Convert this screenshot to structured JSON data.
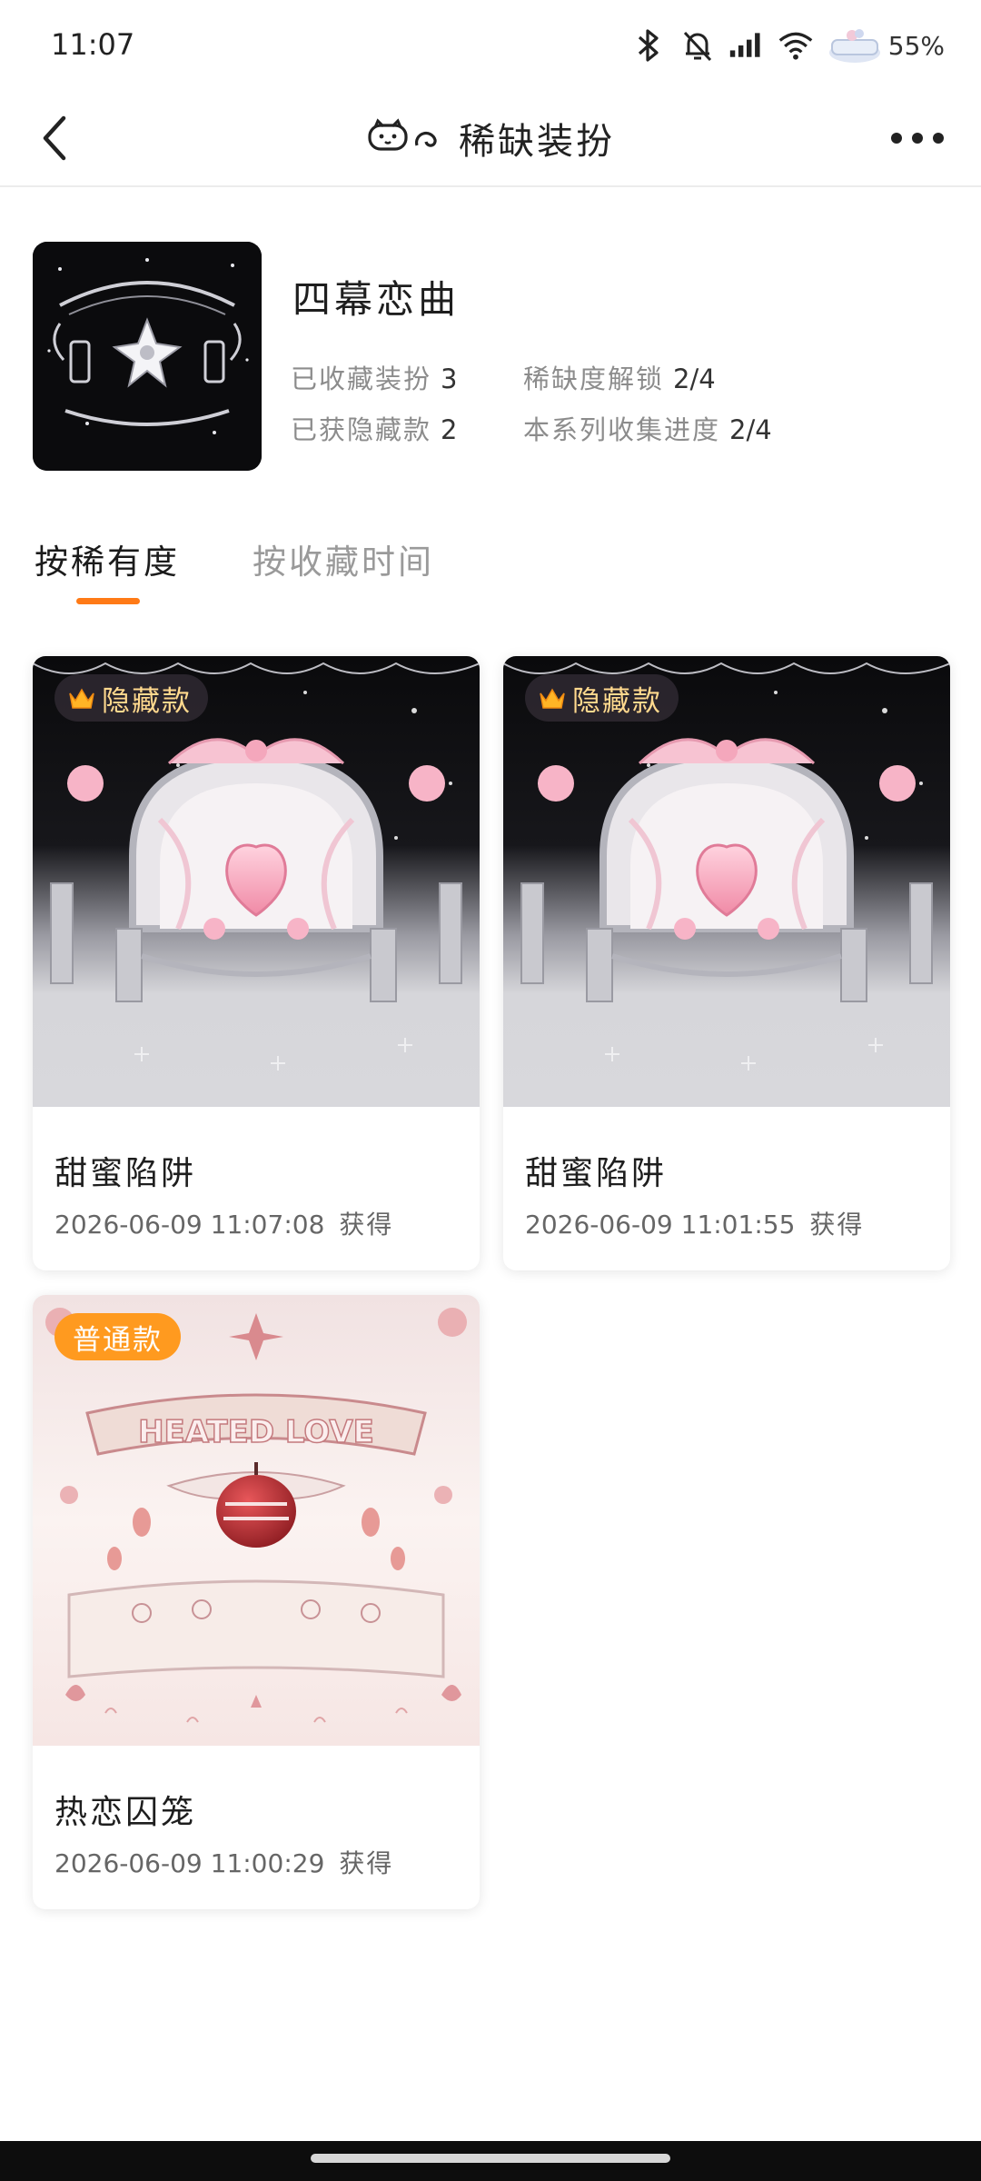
{
  "status_bar": {
    "time": "11:07",
    "battery": "55%",
    "icons": [
      "bluetooth-icon",
      "mute-bell-icon",
      "signal-icon",
      "wifi-icon",
      "battery-icon"
    ]
  },
  "nav": {
    "title": "稀缺装扮",
    "back_icon": "chevron-left-icon",
    "more_icon": "more-dots-icon"
  },
  "series": {
    "name": "四幕恋曲",
    "stats": [
      {
        "label": "已收藏装扮",
        "value": "3"
      },
      {
        "label": "稀缺度解锁",
        "value": "2/4"
      },
      {
        "label": "已获隐藏款",
        "value": "2"
      },
      {
        "label": "本系列收集进度",
        "value": "2/4"
      }
    ]
  },
  "tabs": [
    {
      "label": "按稀有度",
      "active": true
    },
    {
      "label": "按收藏时间",
      "active": false
    }
  ],
  "cards": [
    {
      "badge": "隐藏款",
      "title": "甜蜜陷阱",
      "date": "2026-06-09  11:07:08",
      "obtained": "获得"
    },
    {
      "badge": "隐藏款",
      "title": "甜蜜陷阱",
      "date": "2026-06-09  11:01:55",
      "obtained": "获得"
    },
    {
      "badge": "普通款",
      "title": "热恋囚笼",
      "date": "2026-06-09  11:00:29",
      "obtained": "获得",
      "artwork_text": "HEATED LOVE"
    }
  ],
  "colors": {
    "accent": "#ff7a16",
    "badge_normal": "#ff9a1f",
    "badge_hidden_text": "#ffd98e"
  }
}
